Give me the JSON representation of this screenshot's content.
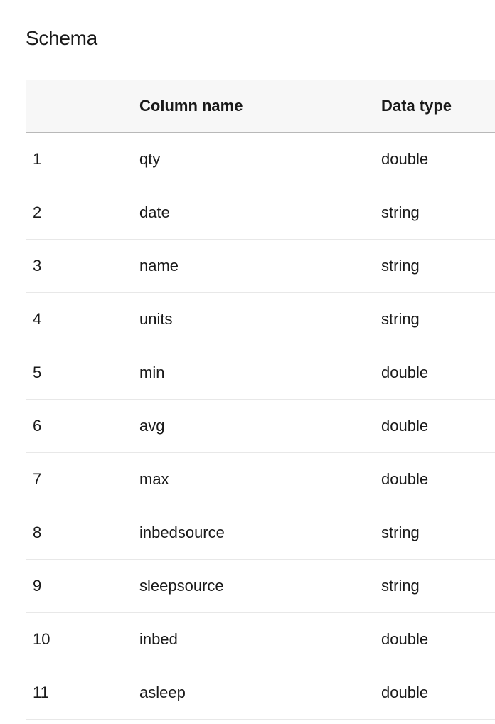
{
  "title": "Schema",
  "headers": {
    "index": "",
    "name": "Column name",
    "type": "Data type"
  },
  "rows": [
    {
      "index": "1",
      "name": "qty",
      "type": "double"
    },
    {
      "index": "2",
      "name": "date",
      "type": "string"
    },
    {
      "index": "3",
      "name": "name",
      "type": "string"
    },
    {
      "index": "4",
      "name": "units",
      "type": "string"
    },
    {
      "index": "5",
      "name": "min",
      "type": "double"
    },
    {
      "index": "6",
      "name": "avg",
      "type": "double"
    },
    {
      "index": "7",
      "name": "max",
      "type": "double"
    },
    {
      "index": "8",
      "name": "inbedsource",
      "type": "string"
    },
    {
      "index": "9",
      "name": "sleepsource",
      "type": "string"
    },
    {
      "index": "10",
      "name": "inbed",
      "type": "double"
    },
    {
      "index": "11",
      "name": "asleep",
      "type": "double"
    }
  ]
}
